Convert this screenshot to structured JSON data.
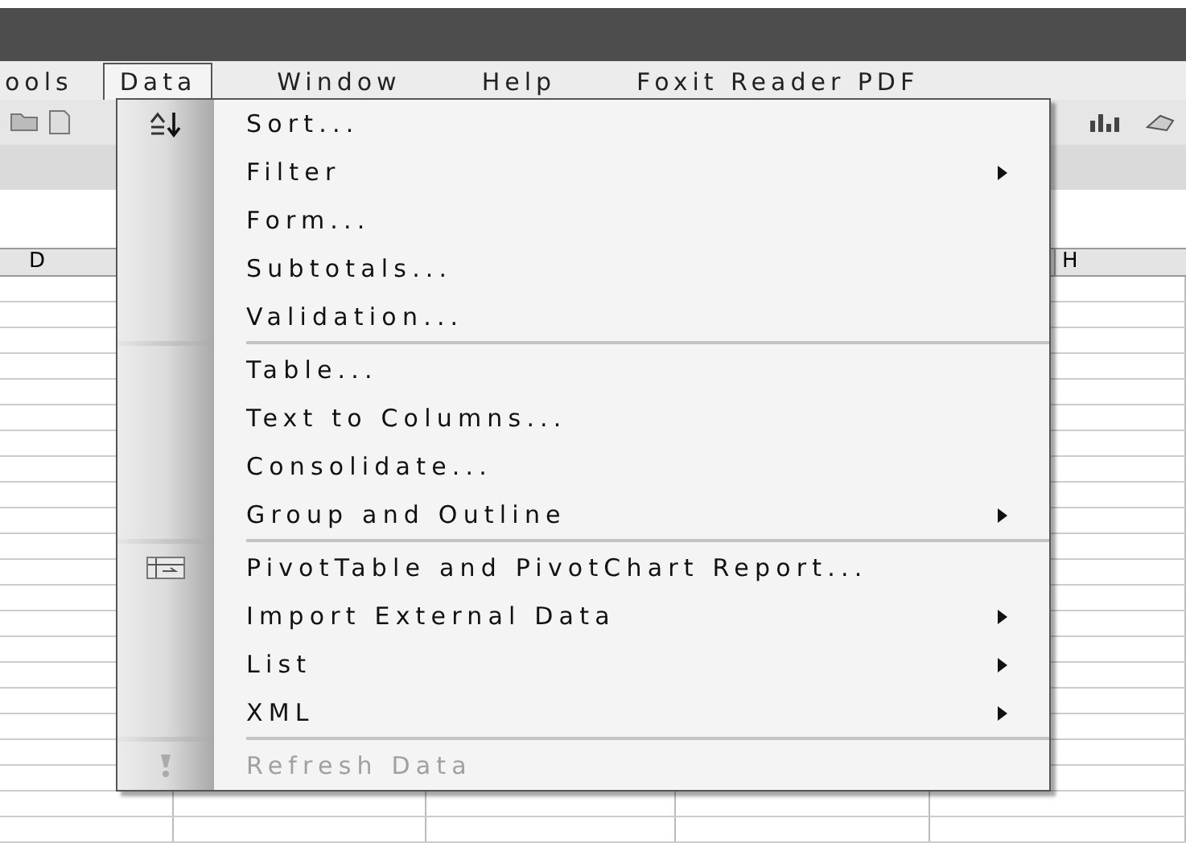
{
  "menu_bar": [
    {
      "label": "ools",
      "selected": false
    },
    {
      "label": "Data",
      "selected": true
    },
    {
      "label": "Window",
      "selected": false
    },
    {
      "label": "Help",
      "selected": false
    },
    {
      "label": "Foxit Reader PDF",
      "selected": false
    }
  ],
  "column_headers": [
    "D",
    "H"
  ],
  "data_menu": [
    {
      "label": "Sort...",
      "kind": "sort",
      "submenu": false,
      "disabled": false,
      "separator_before": false
    },
    {
      "label": "Filter",
      "submenu": true,
      "disabled": false,
      "separator_before": false
    },
    {
      "label": "Form...",
      "submenu": false,
      "disabled": false,
      "separator_before": false
    },
    {
      "label": "Subtotals...",
      "submenu": false,
      "disabled": false,
      "separator_before": false
    },
    {
      "label": "Validation...",
      "submenu": false,
      "disabled": false,
      "separator_before": false
    },
    {
      "label": "Table...",
      "submenu": false,
      "disabled": false,
      "separator_before": true
    },
    {
      "label": "Text to Columns...",
      "submenu": false,
      "disabled": false,
      "separator_before": false
    },
    {
      "label": "Consolidate...",
      "submenu": false,
      "disabled": false,
      "separator_before": false
    },
    {
      "label": "Group and Outline",
      "submenu": true,
      "disabled": false,
      "separator_before": false
    },
    {
      "label": "PivotTable and PivotChart Report...",
      "kind": "pivot",
      "submenu": false,
      "disabled": false,
      "separator_before": true
    },
    {
      "label": "Import External Data",
      "submenu": true,
      "disabled": false,
      "separator_before": false
    },
    {
      "label": "List",
      "submenu": true,
      "disabled": false,
      "separator_before": false
    },
    {
      "label": "XML",
      "submenu": true,
      "disabled": false,
      "separator_before": false
    },
    {
      "label": "Refresh Data",
      "kind": "refresh",
      "submenu": false,
      "disabled": true,
      "separator_before": true
    }
  ]
}
